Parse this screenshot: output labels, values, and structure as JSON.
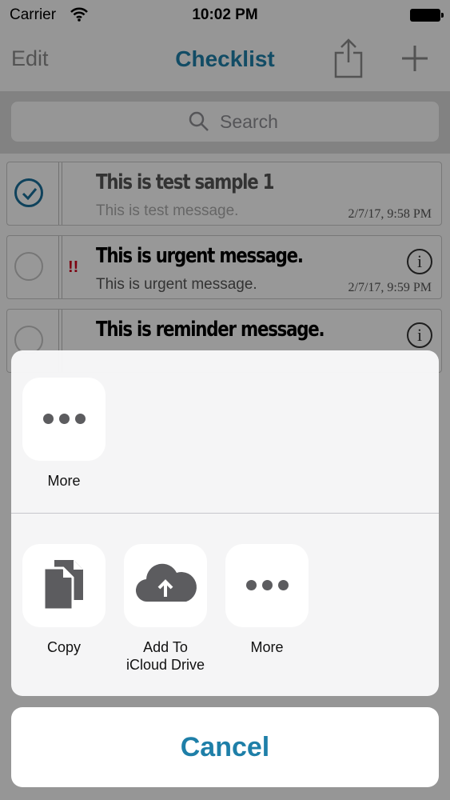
{
  "status_bar": {
    "carrier": "Carrier",
    "time": "10:02 PM"
  },
  "nav": {
    "edit_label": "Edit",
    "title": "Checklist"
  },
  "search": {
    "placeholder": "Search"
  },
  "items": [
    {
      "title": "This is test sample 1",
      "subtitle": "This is test message.",
      "date": "2/7/17, 9:58 PM",
      "checked": true,
      "priority": ""
    },
    {
      "title": "This is urgent message.",
      "subtitle": "This is urgent message.",
      "date": "2/7/17, 9:59 PM",
      "checked": false,
      "priority": "!!"
    },
    {
      "title": "This is reminder message.",
      "checked": false
    }
  ],
  "info_glyph": "i",
  "share_sheet": {
    "row1": [
      {
        "label": "More",
        "icon": "more-dots-icon"
      }
    ],
    "row2": [
      {
        "label": "Copy",
        "icon": "copy-documents-icon"
      },
      {
        "label": "Add To\niCloud Drive",
        "icon": "icloud-upload-icon"
      },
      {
        "label": "More",
        "icon": "more-dots-icon"
      }
    ],
    "cancel_label": "Cancel"
  },
  "colors": {
    "accent": "#1e7fa8",
    "priority": "#d0021b",
    "checked": "#1a6f9a"
  }
}
